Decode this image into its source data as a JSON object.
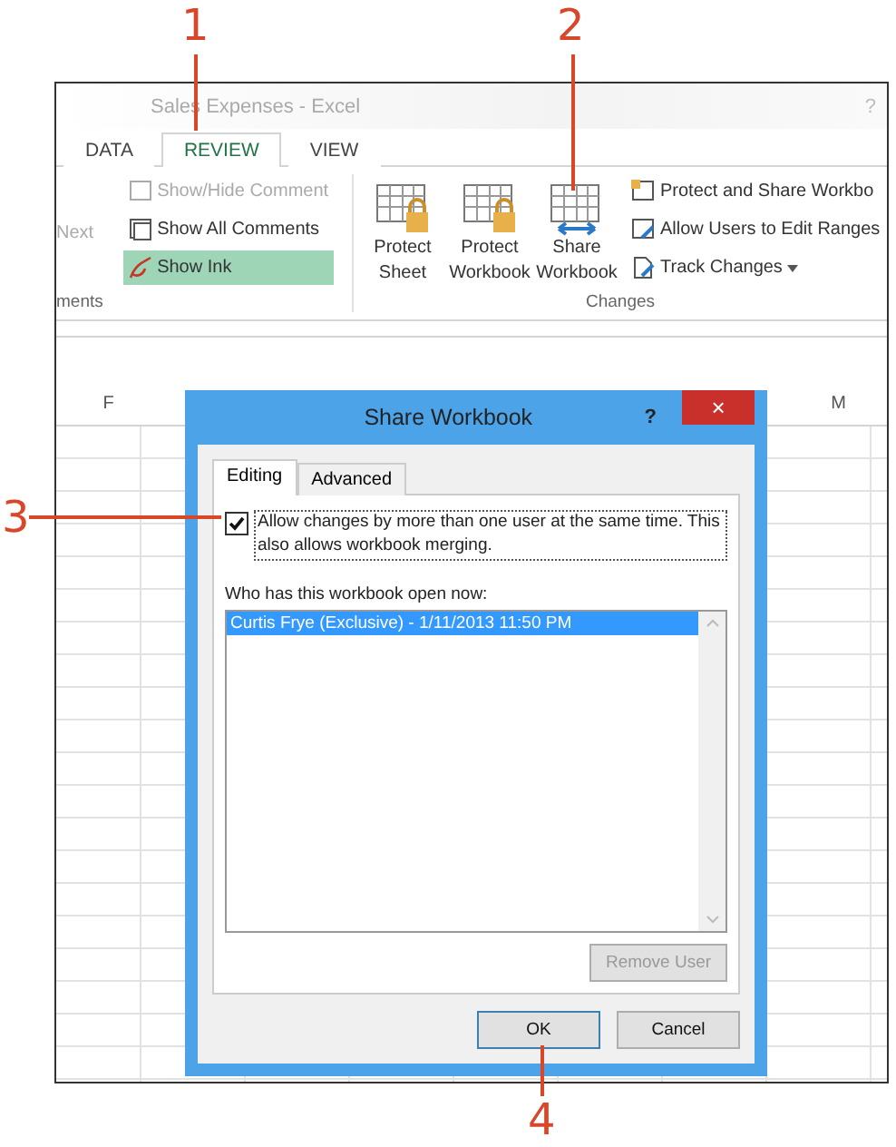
{
  "window": {
    "title": "Sales Expenses - Excel",
    "help": "?"
  },
  "tabs": [
    {
      "label": "DATA",
      "selected": false
    },
    {
      "label": "REVIEW",
      "selected": true
    },
    {
      "label": "VIEW",
      "selected": false
    }
  ],
  "ribbon": {
    "groups": [
      {
        "label": "ments",
        "items": [
          {
            "kind": "partial",
            "label": "Next",
            "disabled": true
          },
          {
            "kind": "small",
            "label": "Show/Hide Comment",
            "disabled": true,
            "selected": false
          },
          {
            "kind": "small",
            "label": "Show All Comments",
            "disabled": false,
            "selected": false
          },
          {
            "kind": "small",
            "label": "Show Ink",
            "disabled": false,
            "selected": true
          }
        ]
      },
      {
        "label": "Changes",
        "items": [
          {
            "kind": "large",
            "label": "Protect Sheet"
          },
          {
            "kind": "large",
            "label": "Protect Workbook"
          },
          {
            "kind": "large",
            "label": "Share Workbook"
          },
          {
            "kind": "small",
            "label": "Protect and Share Workbo",
            "dropdown": false
          },
          {
            "kind": "small",
            "label": "Allow Users to Edit Ranges",
            "dropdown": false
          },
          {
            "kind": "small",
            "label": "Track Changes",
            "dropdown": true
          }
        ]
      }
    ]
  },
  "grid": {
    "columns": [
      "F",
      "M"
    ]
  },
  "dialog": {
    "title": "Share Workbook",
    "help": "?",
    "close": "×",
    "tabs": [
      {
        "label": "Editing",
        "selected": true
      },
      {
        "label": "Advanced",
        "selected": false
      }
    ],
    "allow_changes": {
      "label": "Allow changes by more than one user at the same time. This also allows workbook merging.",
      "checked": true
    },
    "users_label": "Who has this workbook open now:",
    "users": [
      {
        "label": "Curtis Frye (Exclusive) - 1/11/2013 11:50 PM",
        "selected": true
      }
    ],
    "remove_button": {
      "label": "Remove User",
      "disabled": true
    },
    "buttons": [
      {
        "label": "OK",
        "default": true
      },
      {
        "label": "Cancel",
        "default": false
      }
    ]
  },
  "callouts": [
    {
      "label": "1"
    },
    {
      "label": "2"
    },
    {
      "label": "3"
    },
    {
      "label": "4"
    }
  ]
}
